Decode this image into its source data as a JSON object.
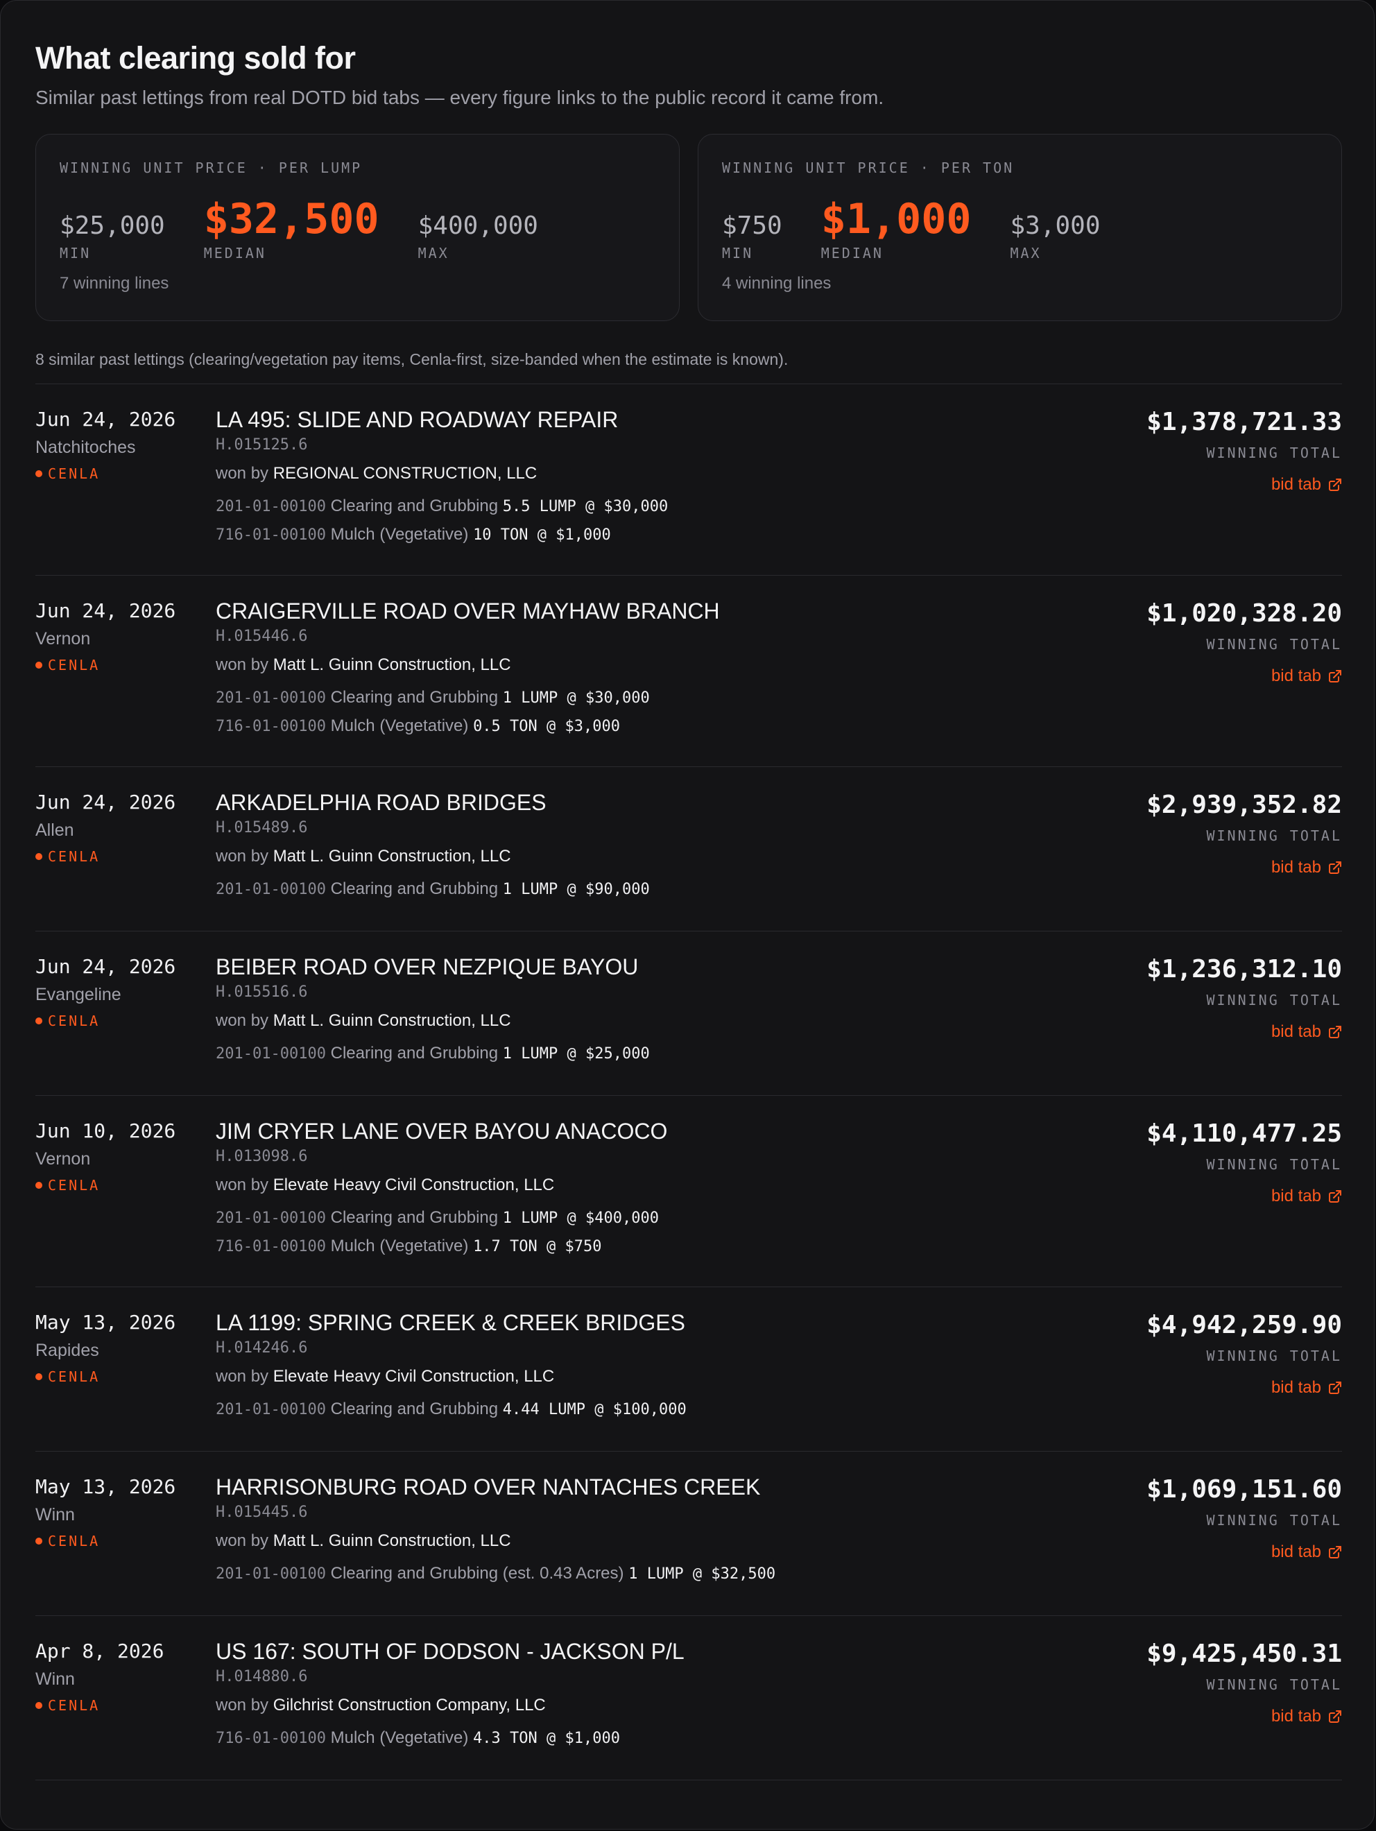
{
  "header": {
    "title": "What clearing sold for",
    "subtitle": "Similar past lettings from real DOTD bid tabs — every figure links to the public record it came from."
  },
  "stats": [
    {
      "label": "WINNING UNIT PRICE · PER LUMP",
      "min": "$25,000",
      "median": "$32,500",
      "max": "$400,000",
      "min_label": "MIN",
      "median_label": "MEDIAN",
      "max_label": "MAX",
      "footnote": "7 winning lines"
    },
    {
      "label": "WINNING UNIT PRICE · PER TON",
      "min": "$750",
      "median": "$1,000",
      "max": "$3,000",
      "min_label": "MIN",
      "median_label": "MEDIAN",
      "max_label": "MAX",
      "footnote": "4 winning lines"
    }
  ],
  "summary": "8 similar past lettings (clearing/vegetation pay items, Cenla-first, size-banded when the estimate is known).",
  "labels": {
    "won_by": "won by",
    "winning_total": "WINNING TOTAL",
    "bid_tab": "bid tab"
  },
  "colors": {
    "accent": "#ff5a1f",
    "background": "#141416"
  },
  "lettings": [
    {
      "date": "Jun 24, 2026",
      "parish": "Natchitoches",
      "region": "CENLA",
      "name": "LA 495: SLIDE AND ROADWAY REPAIR",
      "id": "H.015125.6",
      "winner": "REGIONAL CONSTRUCTION, LLC",
      "total": "$1,378,721.33",
      "items": [
        {
          "code": "201-01-00100",
          "desc": "Clearing and Grubbing",
          "qty": "5.5 LUMP @ $30,000"
        },
        {
          "code": "716-01-00100",
          "desc": "Mulch (Vegetative)",
          "qty": "10 TON @ $1,000"
        }
      ]
    },
    {
      "date": "Jun 24, 2026",
      "parish": "Vernon",
      "region": "CENLA",
      "name": "CRAIGERVILLE ROAD OVER MAYHAW BRANCH",
      "id": "H.015446.6",
      "winner": "Matt L. Guinn Construction, LLC",
      "total": "$1,020,328.20",
      "items": [
        {
          "code": "201-01-00100",
          "desc": "Clearing and Grubbing",
          "qty": "1 LUMP @ $30,000"
        },
        {
          "code": "716-01-00100",
          "desc": "Mulch (Vegetative)",
          "qty": "0.5 TON @ $3,000"
        }
      ]
    },
    {
      "date": "Jun 24, 2026",
      "parish": "Allen",
      "region": "CENLA",
      "name": "ARKADELPHIA ROAD BRIDGES",
      "id": "H.015489.6",
      "winner": "Matt L. Guinn Construction, LLC",
      "total": "$2,939,352.82",
      "items": [
        {
          "code": "201-01-00100",
          "desc": "Clearing and Grubbing",
          "qty": "1 LUMP @ $90,000"
        }
      ]
    },
    {
      "date": "Jun 24, 2026",
      "parish": "Evangeline",
      "region": "CENLA",
      "name": "BEIBER ROAD OVER NEZPIQUE BAYOU",
      "id": "H.015516.6",
      "winner": "Matt L. Guinn Construction, LLC",
      "total": "$1,236,312.10",
      "items": [
        {
          "code": "201-01-00100",
          "desc": "Clearing and Grubbing",
          "qty": "1 LUMP @ $25,000"
        }
      ]
    },
    {
      "date": "Jun 10, 2026",
      "parish": "Vernon",
      "region": "CENLA",
      "name": "JIM CRYER LANE OVER BAYOU ANACOCO",
      "id": "H.013098.6",
      "winner": "Elevate Heavy Civil Construction, LLC",
      "total": "$4,110,477.25",
      "items": [
        {
          "code": "201-01-00100",
          "desc": "Clearing and Grubbing",
          "qty": "1 LUMP @ $400,000"
        },
        {
          "code": "716-01-00100",
          "desc": "Mulch (Vegetative)",
          "qty": "1.7 TON @ $750"
        }
      ]
    },
    {
      "date": "May 13, 2026",
      "parish": "Rapides",
      "region": "CENLA",
      "name": "LA 1199: SPRING CREEK & CREEK BRIDGES",
      "id": "H.014246.6",
      "winner": "Elevate Heavy Civil Construction, LLC",
      "total": "$4,942,259.90",
      "items": [
        {
          "code": "201-01-00100",
          "desc": "Clearing and Grubbing",
          "qty": "4.44 LUMP @ $100,000"
        }
      ]
    },
    {
      "date": "May 13, 2026",
      "parish": "Winn",
      "region": "CENLA",
      "name": "HARRISONBURG ROAD OVER NANTACHES CREEK",
      "id": "H.015445.6",
      "winner": "Matt L. Guinn Construction, LLC",
      "total": "$1,069,151.60",
      "items": [
        {
          "code": "201-01-00100",
          "desc": "Clearing and Grubbing (est. 0.43 Acres)",
          "qty": "1 LUMP @ $32,500"
        }
      ]
    },
    {
      "date": "Apr 8, 2026",
      "parish": "Winn",
      "region": "CENLA",
      "name": "US 167: SOUTH OF DODSON - JACKSON P/L",
      "id": "H.014880.6",
      "winner": "Gilchrist Construction Company, LLC",
      "total": "$9,425,450.31",
      "items": [
        {
          "code": "716-01-00100",
          "desc": "Mulch (Vegetative)",
          "qty": "4.3 TON @ $1,000"
        }
      ]
    }
  ]
}
